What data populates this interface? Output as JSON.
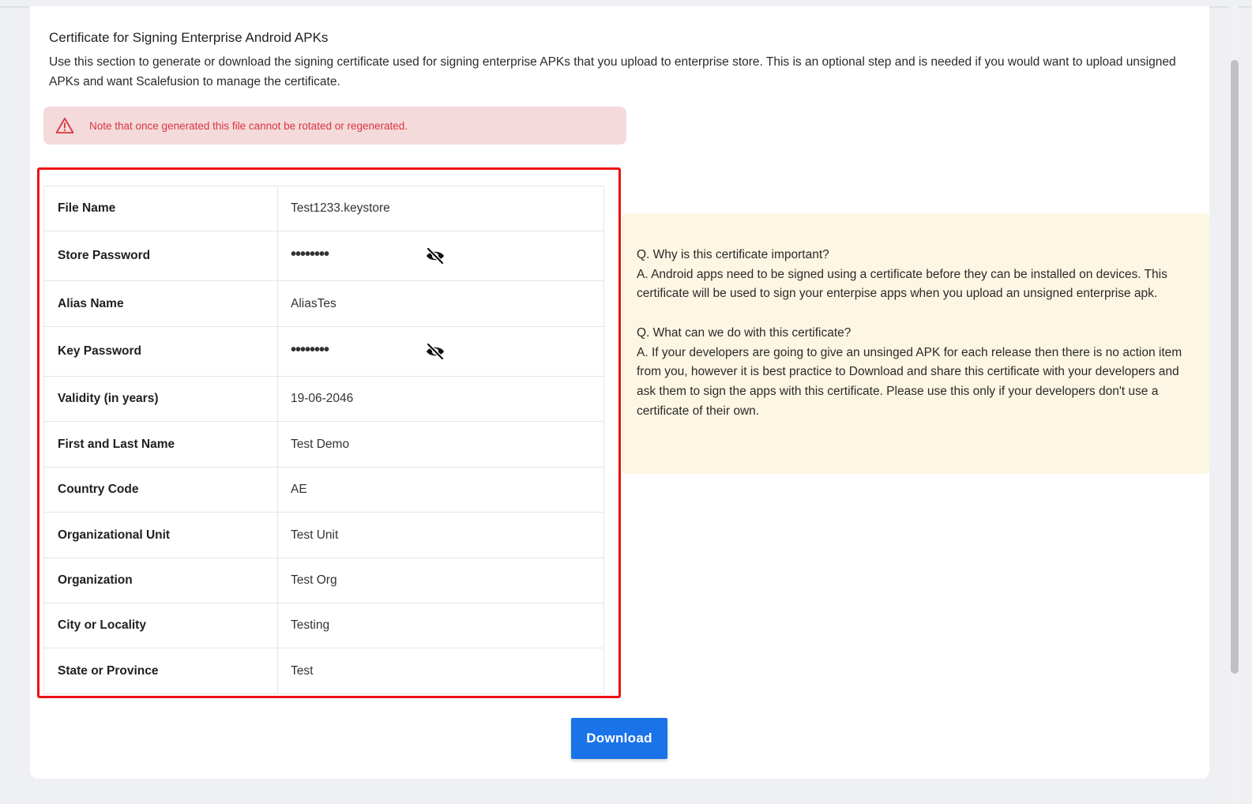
{
  "section": {
    "title": "Certificate for Signing Enterprise Android APKs",
    "description": "Use this section to generate or download the signing certificate used for signing enterprise APKs that you upload to enterprise store. This is an optional step and is needed if you would want to upload unsigned APKs and want Scalefusion to manage the certificate."
  },
  "alert": {
    "icon": "warning-triangle-icon",
    "message": "Note that once generated this file cannot be rotated or regenerated."
  },
  "details": {
    "rows": [
      {
        "label": "File Name",
        "value": "Test1233.keystore"
      },
      {
        "label": "Store Password",
        "value": "••••••••",
        "icon": "eye-slash-icon"
      },
      {
        "label": "Alias Name",
        "value": "AliasTes"
      },
      {
        "label": "Key Password",
        "value": "••••••••",
        "icon": "eye-slash-icon"
      },
      {
        "label": "Validity (in years)",
        "value": "19-06-2046"
      },
      {
        "label": "First and Last Name",
        "value": "Test Demo"
      },
      {
        "label": "Country Code",
        "value": "AE"
      },
      {
        "label": "Organizational Unit",
        "value": "Test Unit"
      },
      {
        "label": "Organization",
        "value": "Test Org"
      },
      {
        "label": "City or Locality",
        "value": "Testing"
      },
      {
        "label": "State or Province",
        "value": "Test"
      }
    ]
  },
  "faq": {
    "q1": "Q. Why is this certificate important?",
    "a1": "A. Android apps need to be signed using a certificate before they can be installed on devices. This certificate will be used to sign your enterpise apps when you upload an unsigned enterprise apk.",
    "q2": "Q. What can we do with this certificate?",
    "a2": "A. If your developers are going to give an unsinged APK for each release then there is no action item from you, however it is best practice to Download and share this certificate with your developers and ask them to sign the apps with this certificate. Please use this only if your developers don't use a certificate of their own."
  },
  "actions": {
    "download_label": "Download"
  },
  "colors": {
    "primary": "#1a73e8",
    "alert_bg": "#f4dadb",
    "alert_text": "#d9363e",
    "highlight_frame": "#ee1111",
    "faq_bg": "#fdf6e3"
  }
}
